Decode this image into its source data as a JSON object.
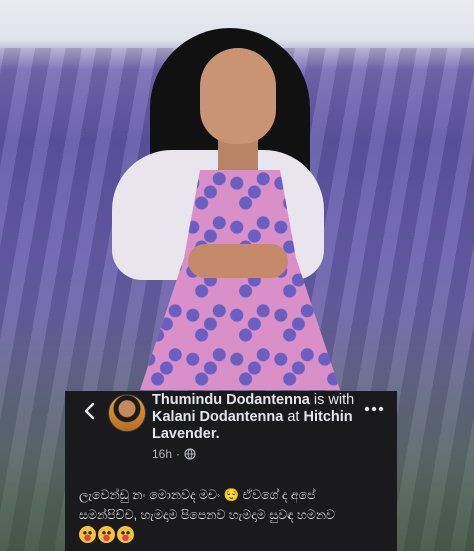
{
  "post": {
    "author": "Thumindu Dodantenna",
    "with_prefix": "is with",
    "tagged_person": "Kalani Dodantenna",
    "at_prefix": "at",
    "location": "Hitchin Lavender.",
    "timestamp": "16h",
    "separator": "·",
    "audience_icon": "globe-icon",
    "text_line1": "ලැවෙන්ඩු නං මොනවද මචං 😌 ඒවගේ ද අපේ",
    "text_line2": "සමන්පිච්ච, හැමදාම පිපෙනව හැමදාම සුවඳ හමනව",
    "emojis": [
      "🥰",
      "🥰",
      "🥰"
    ]
  },
  "icons": {
    "back": "chevron-left-icon",
    "more": "more-horizontal-icon"
  },
  "colors": {
    "card_background": "#1a1a1d",
    "primary_text": "#e4e6eb",
    "secondary_text": "#b0b3b8"
  }
}
